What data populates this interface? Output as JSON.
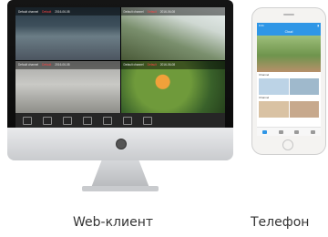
{
  "captions": {
    "web_client": "Web-клиент",
    "phone": "Телефон"
  },
  "desktop_app": {
    "camera_tiles": [
      {
        "name": "Default channel",
        "status": "Default",
        "time": "2016-06-08"
      },
      {
        "name": "Default channel",
        "status": "Default",
        "time": "2016-06-08"
      },
      {
        "name": "Default channel",
        "status": "Default",
        "time": "2016-06-08"
      },
      {
        "name": "Default channel",
        "status": "Default",
        "time": "2016-06-08"
      }
    ],
    "toolbar_icons": [
      "home-icon",
      "grid-icon",
      "folder-icon",
      "record-icon",
      "playback-icon",
      "settings-icon",
      "fullscreen-icon"
    ]
  },
  "mobile_app": {
    "status_time": "9:41",
    "nav_title": "Cloud",
    "sections": [
      "Channel",
      "Channel"
    ],
    "tabs": [
      "live-icon",
      "playback-icon",
      "files-icon",
      "me-icon"
    ],
    "accent": "#2f96e6"
  }
}
